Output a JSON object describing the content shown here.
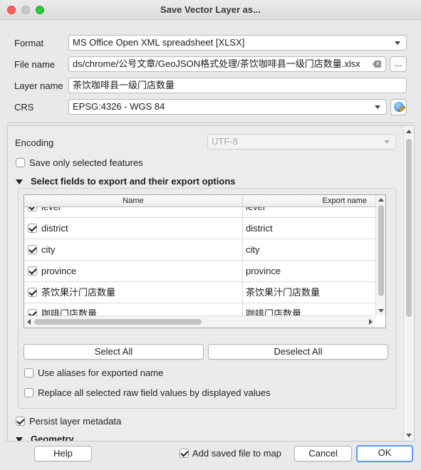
{
  "window": {
    "title": "Save Vector Layer as..."
  },
  "form": {
    "format_label": "Format",
    "format_value": "MS Office Open XML spreadsheet [XLSX]",
    "filename_label": "File name",
    "filename_value": "ds/chrome/公号文章/GeoJSON格式处理/茶饮咖啡县一级门店数量.xlsx",
    "browse_label": "...",
    "layername_label": "Layer name",
    "layername_value": "茶饮咖啡县一级门店数量",
    "crs_label": "CRS",
    "crs_value": "EPSG:4326 - WGS 84"
  },
  "options": {
    "encoding_label": "Encoding",
    "encoding_value": "UTF-8",
    "save_selected_label": "Save only selected features",
    "fields_section_title": "Select fields to export and their export options",
    "table": {
      "col_name": "Name",
      "col_export": "Export name",
      "rows": [
        {
          "name": "level",
          "export": "level",
          "checked": true
        },
        {
          "name": "district",
          "export": "district",
          "checked": true
        },
        {
          "name": "city",
          "export": "city",
          "checked": true
        },
        {
          "name": "province",
          "export": "province",
          "checked": true
        },
        {
          "name": "茶饮果汁门店数量",
          "export": "茶饮果汁门店数量",
          "checked": true
        },
        {
          "name": "咖啡门店数量",
          "export": "咖啡门店数量",
          "checked": true
        }
      ]
    },
    "select_all_label": "Select All",
    "deselect_all_label": "Deselect All",
    "use_aliases_label": "Use aliases for exported name",
    "replace_values_label": "Replace all selected raw field values by displayed values",
    "persist_metadata_label": "Persist layer metadata",
    "geometry_section_title": "Geometry"
  },
  "footer": {
    "help_label": "Help",
    "add_saved_label": "Add saved file to map",
    "cancel_label": "Cancel",
    "ok_label": "OK"
  },
  "colors": {
    "accent": "#5a9cf8",
    "close": "#fd5e57",
    "max": "#2ac940"
  }
}
